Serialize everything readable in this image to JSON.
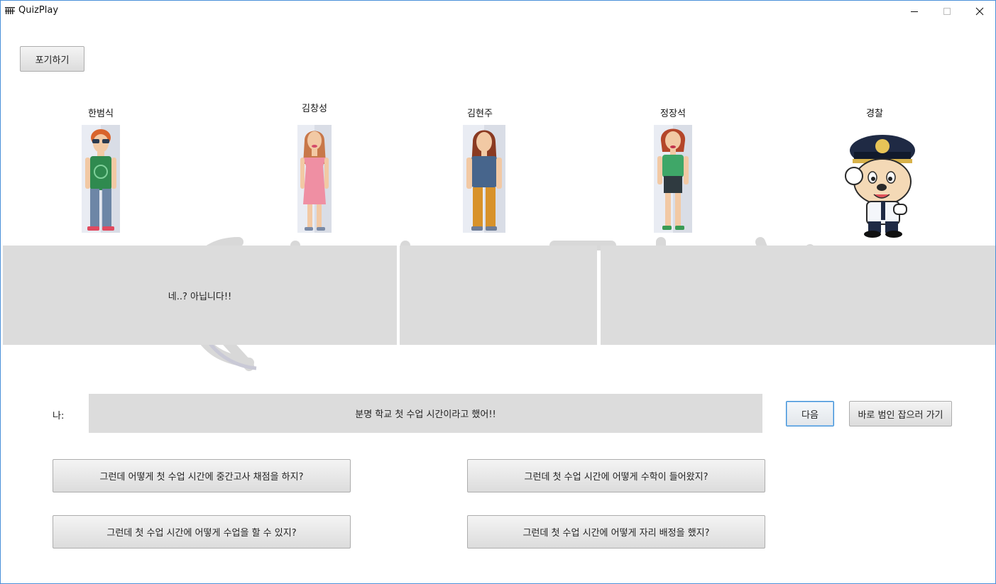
{
  "window": {
    "title": "QuizPlay"
  },
  "toolbar": {
    "give_up_label": "포기하기"
  },
  "characters": [
    {
      "name": "한범식",
      "icon": "man-sunglasses-icon"
    },
    {
      "name": "김창성",
      "icon": "woman-pink-dress-icon"
    },
    {
      "name": "김현주",
      "icon": "woman-blue-shirt-icon"
    },
    {
      "name": "정장석",
      "icon": "woman-green-top-icon"
    },
    {
      "name": "경찰",
      "icon": "police-mascot-icon"
    }
  ],
  "speech": {
    "panel1": "네..? 아닙니다!!",
    "panel2": "",
    "panel3": ""
  },
  "me": {
    "label": "나:",
    "statement": "분명 학교 첫 수업 시간이라고 했어!!",
    "next_label": "다음",
    "arrest_label": "바로 범인 잡으러 가기"
  },
  "choices": [
    "그런데 어떻게 첫 수업 시간에 중간고사 채점을 하지?",
    "그런데 첫 수업 시간에 어떻게 수학이 들어왔지?",
    "그런데 첫 수업 시간에 어떻게 수업을 할 수 있지?",
    "그런데 첫 수업 시간에 어떻게 자리 배정을 했지?"
  ],
  "colors": {
    "panel_bg": "#dcdcdc",
    "focus_border": "#3c8fd6",
    "window_border": "#4a90d9"
  }
}
